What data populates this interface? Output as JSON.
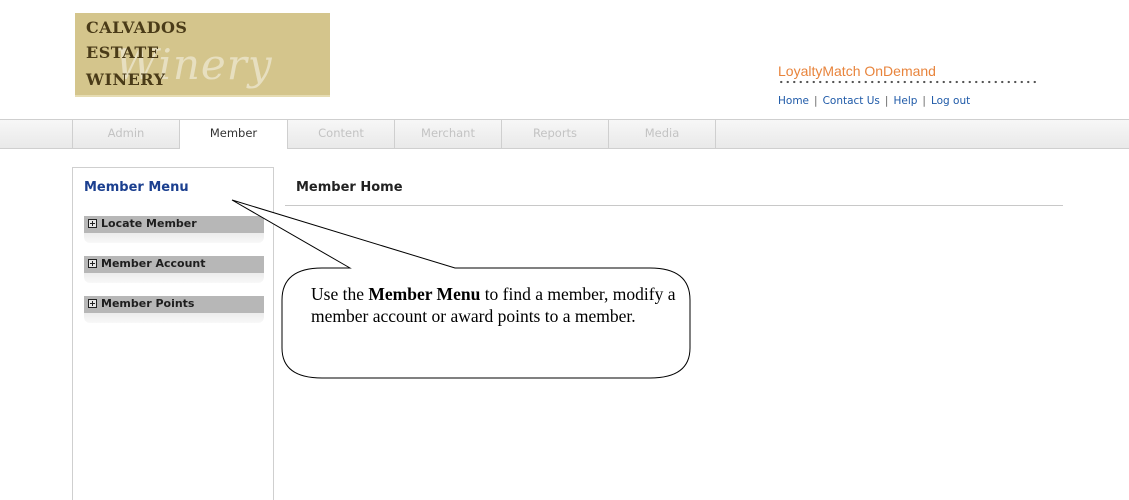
{
  "logo": {
    "line1": "CALVADOS",
    "line2": "ESTATE",
    "line3": "WINERY",
    "script": "Winery"
  },
  "brand": {
    "name": "LoyaltyMatch OnDemand",
    "color": "#e8843c"
  },
  "util_links": {
    "home": "Home",
    "contact": "Contact Us",
    "help": "Help",
    "logout": "Log out",
    "separator": "|"
  },
  "nav": {
    "tabs": [
      {
        "label": "Admin",
        "active": false
      },
      {
        "label": "Member",
        "active": true
      },
      {
        "label": "Content",
        "active": false
      },
      {
        "label": "Merchant",
        "active": false
      },
      {
        "label": "Reports",
        "active": false
      },
      {
        "label": "Media",
        "active": false
      }
    ]
  },
  "sidebar": {
    "title": "Member Menu",
    "items": [
      {
        "label": "Locate Member",
        "icon": "plus-icon"
      },
      {
        "label": "Member Account",
        "icon": "plus-icon"
      },
      {
        "label": "Member Points",
        "icon": "plus-icon"
      }
    ]
  },
  "main": {
    "title": "Member Home"
  },
  "callout": {
    "prefix": "Use the ",
    "bold": "Member Menu",
    "suffix": " to find a member, modify a member account or award points to a member."
  }
}
